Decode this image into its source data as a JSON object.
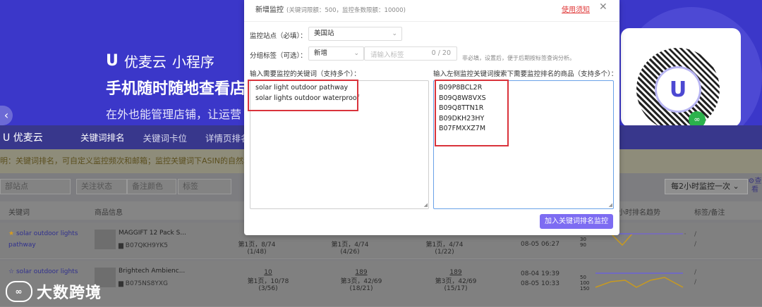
{
  "background": {
    "banner": {
      "brand_name": "优麦云",
      "brand_suffix": "小程序",
      "headline": "手机随时随地查看店",
      "subline": "在外也能管理店铺，让运营"
    },
    "nav": {
      "brand": "优麦云",
      "items": [
        "关键词排名",
        "关键词卡位",
        "详情页排名"
      ]
    },
    "notice": "明：关键词排名，可自定义监控频次和邮箱；监控关键词下ASIN的自然和广告相对与",
    "filters": [
      "部站点",
      "关注状态",
      "备注颜色",
      "标签"
    ],
    "frequency": "每2小时监控一次",
    "help": "查看",
    "table_headers": [
      "关键词",
      "商品信息",
      "小时排名趋势",
      "标签/备注"
    ],
    "rows": [
      {
        "keyword": "solar outdoor lights pathway",
        "title": "MAGGIFT 12 Pack S...",
        "asin": "B07QKH9YK5",
        "c1_rank": "",
        "c1_pos": "第1页，8/74 (1/48)",
        "c2_rank": "",
        "c2_pos": "第1页，4/74 (4/26)",
        "c3_rank": "",
        "c3_pos": "第1页，4/74 (1/22)",
        "time": "08-05 06:27",
        "tags": "/"
      },
      {
        "keyword": "solar outdoor lights",
        "title": "Brightech Ambienc...",
        "asin": "B075NS8YXG",
        "c1_rank": "10",
        "c1_pos": "第1页，10/78 (3/56)",
        "c2_rank": "189",
        "c2_pos": "第3页，42/69 (18/21)",
        "c3_rank": "189",
        "c3_pos": "第3页，42/69 (15/17)",
        "time": "08-04 19:39",
        "time2": "08-05 10:33",
        "tags": "/"
      }
    ],
    "trend_axis": [
      "50",
      "100",
      "150"
    ],
    "trend_axis_top": [
      "30",
      "90"
    ],
    "watermark": "大数跨境"
  },
  "modal": {
    "title": "新增监控",
    "title_hint": "(关键词限额：500，监控条数限额：10000)",
    "rules_link": "使用须知",
    "close_symbol": "✕",
    "site_label": "监控站点（必填）：",
    "site_value": "美国站",
    "group_label": "分组标签（可选）：",
    "group_value": "新增",
    "tag_placeholder": "请输入标签",
    "tag_count": "0 / 20",
    "tag_tip": "非必填，设置后，便于后期按标签查询分析。",
    "keywords_label": "输入需要监控的关键词（支持多个）：",
    "keywords": [
      "solar light outdoor pathway",
      "solar lights outdoor waterproof"
    ],
    "asins_label": "输入左侧监控关键词搜索下需要监控排名的商品（支持多个）：",
    "asins": [
      "B09P8BCL2R",
      "B09Q8W8VXS",
      "B09Q8TTN1R",
      "B09DKH23HY",
      "B07FMXXZ7M"
    ],
    "submit_label": "加入关键词排名监控"
  },
  "colors": {
    "accent": "#7d6cf2",
    "banner": "#3b37c9",
    "highlight": "#d9333b",
    "link_red": "#e03a3a",
    "focus_border": "#6aa2e8"
  }
}
